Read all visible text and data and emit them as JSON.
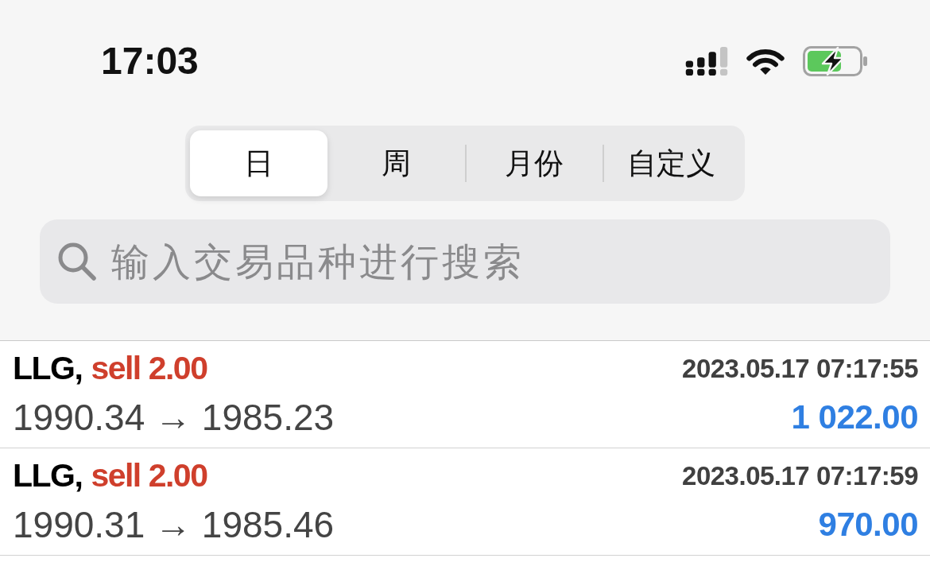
{
  "status_bar": {
    "time": "17:03"
  },
  "segments": [
    {
      "label": "日",
      "selected": true
    },
    {
      "label": "周",
      "selected": false
    },
    {
      "label": "月份",
      "selected": false
    },
    {
      "label": "自定义",
      "selected": false
    }
  ],
  "search": {
    "placeholder": "输入交易品种进行搜索"
  },
  "trades": [
    {
      "symbol": "LLG,",
      "order": "sell 2.00",
      "time": "2023.05.17 07:17:55",
      "prices": "1990.34 → 1985.23",
      "profit": "1 022.00"
    },
    {
      "symbol": "LLG,",
      "order": "sell 2.00",
      "time": "2023.05.17 07:17:59",
      "prices": "1990.31 → 1985.46",
      "profit": "970.00"
    }
  ]
}
